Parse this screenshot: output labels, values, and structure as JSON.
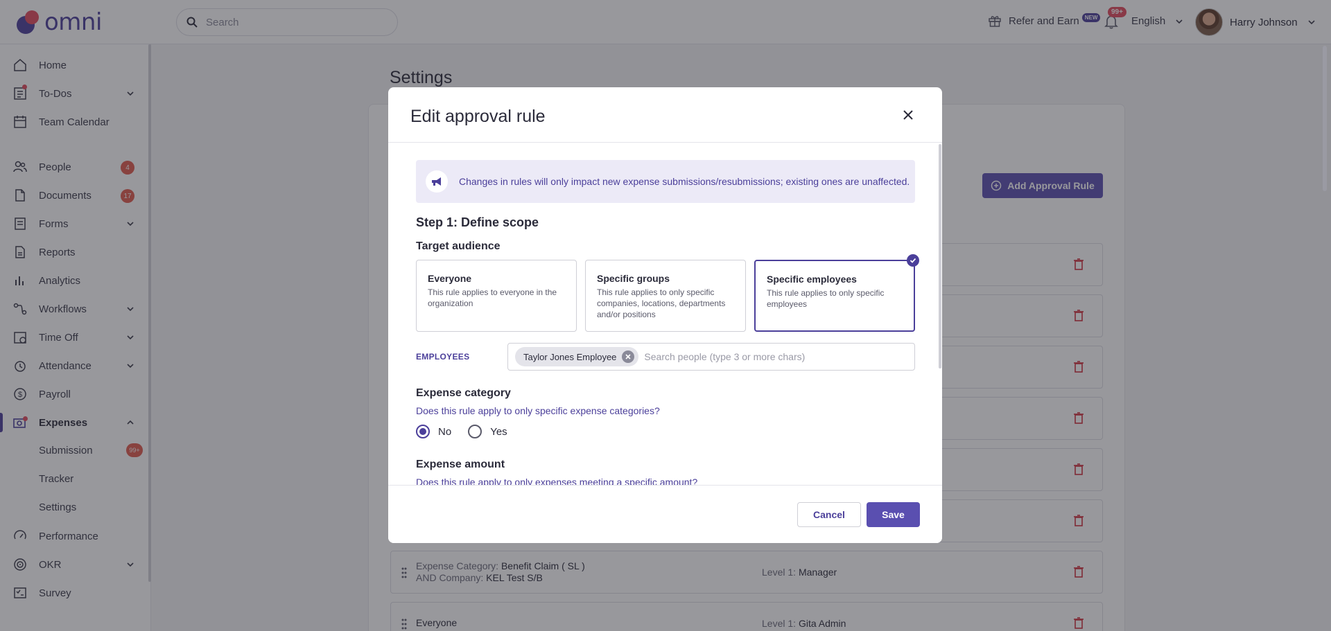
{
  "app": {
    "logo_text": "omni"
  },
  "topbar": {
    "search_placeholder": "Search",
    "refer_label": "Refer and Earn",
    "new_badge": "NEW",
    "notification_count": "99+",
    "language": "English",
    "user_name": "Harry Johnson"
  },
  "sidebar": {
    "items": [
      {
        "label": "Home",
        "icon": "home-icon"
      },
      {
        "label": "To-Dos",
        "icon": "todo-icon"
      },
      {
        "label": "Team Calendar",
        "icon": "calendar-icon"
      },
      {
        "label": "People",
        "icon": "people-icon",
        "badge": "4"
      },
      {
        "label": "Documents",
        "icon": "documents-icon",
        "badge": "17"
      },
      {
        "label": "Forms",
        "icon": "forms-icon"
      },
      {
        "label": "Reports",
        "icon": "reports-icon"
      },
      {
        "label": "Analytics",
        "icon": "analytics-icon"
      },
      {
        "label": "Workflows",
        "icon": "workflows-icon"
      },
      {
        "label": "Time Off",
        "icon": "time-off-icon"
      },
      {
        "label": "Attendance",
        "icon": "attendance-icon"
      },
      {
        "label": "Payroll",
        "icon": "payroll-icon"
      },
      {
        "label": "Expenses",
        "icon": "expenses-icon"
      },
      {
        "label": "Performance",
        "icon": "performance-icon"
      },
      {
        "label": "OKR",
        "icon": "okr-icon"
      },
      {
        "label": "Survey",
        "icon": "survey-icon"
      }
    ],
    "expenses_sub": [
      {
        "label": "Submission",
        "badge": "99+"
      },
      {
        "label": "Tracker"
      },
      {
        "label": "Settings"
      }
    ]
  },
  "main": {
    "title": "Settings",
    "add_rule_label": "Add Approval Rule",
    "rules": [
      {
        "line1_key": "Expense Category:",
        "line1_val": "Benefit Claim ( SL )",
        "line2_key": "AND Company:",
        "line2_val": "KEL Test S/B",
        "level_key": "Level 1:",
        "level_val": "Manager"
      },
      {
        "line1_key": "",
        "line1_val": "Everyone",
        "line2_key": "",
        "line2_val": "",
        "level_key": "Level 1:",
        "level_val": "Gita Admin"
      }
    ]
  },
  "modal": {
    "title": "Edit approval rule",
    "info_text": "Changes in rules will only impact new expense submissions/resubmissions; existing ones are unaffected.",
    "step_title": "Step 1: Define scope",
    "target_audience_label": "Target audience",
    "options": [
      {
        "title": "Everyone",
        "desc": "This rule applies to everyone in the organization"
      },
      {
        "title": "Specific groups",
        "desc": "This rule applies to only specific companies, locations, departments and/or positions"
      },
      {
        "title": "Specific employees",
        "desc": "This rule applies to only specific employees"
      }
    ],
    "selected_option": "Specific employees",
    "employees_label": "EMPLOYEES",
    "employee_chip": "Taylor Jones Employee",
    "employee_placeholder": "Search people (type 3 or more chars)",
    "expense_category_label": "Expense category",
    "expense_category_question": "Does this rule apply to only specific expense categories?",
    "radio_no": "No",
    "radio_yes": "Yes",
    "selected_radio": "No",
    "expense_amount_label": "Expense amount",
    "expense_amount_question": "Does this rule apply to only expenses meeting a specific amount?",
    "cancel_label": "Cancel",
    "save_label": "Save"
  },
  "colors": {
    "brand": "#4b3f9a",
    "accent_button": "#5a4fb0",
    "badge_red": "#e05a4e",
    "logo_red": "#e24a5c"
  }
}
